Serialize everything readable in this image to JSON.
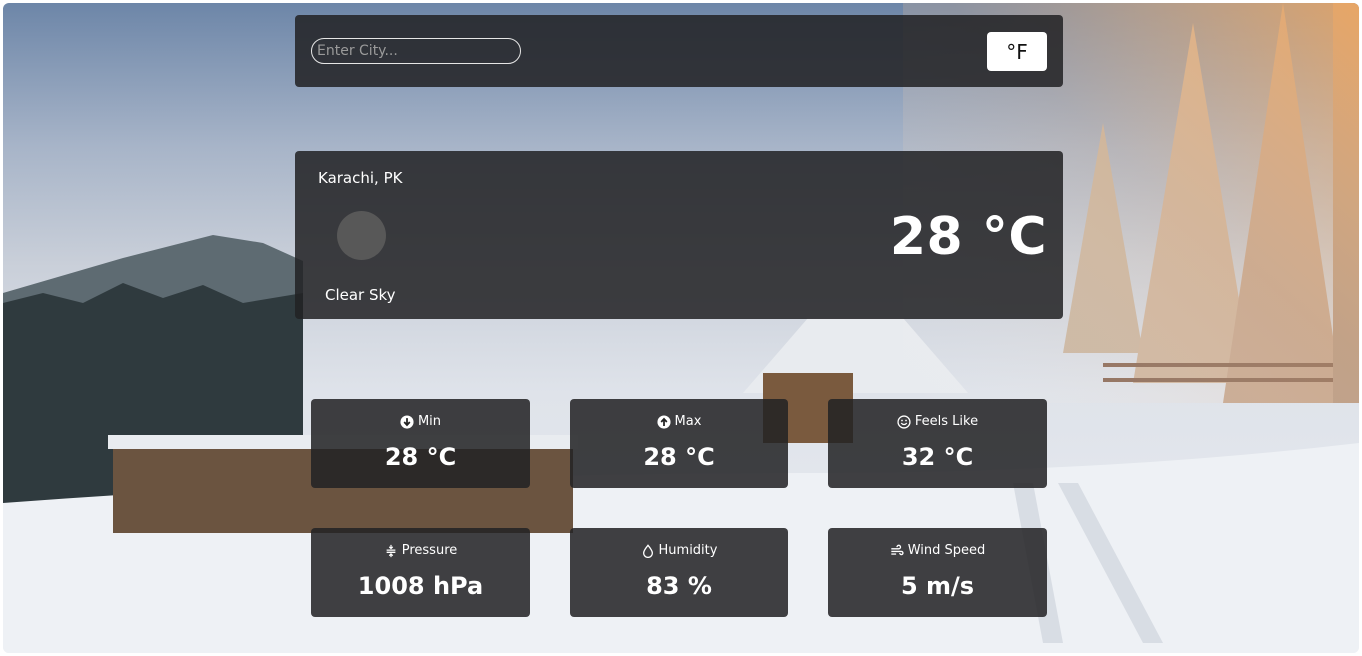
{
  "search": {
    "placeholder": "Enter City..."
  },
  "unit_toggle": {
    "label": "°F"
  },
  "current": {
    "location": "Karachi, PK",
    "description": "Clear Sky",
    "temperature": "28 °C"
  },
  "stats": [
    {
      "label": "Min",
      "value": "28 °C",
      "icon": "arrow-down-circle-icon"
    },
    {
      "label": "Max",
      "value": "28 °C",
      "icon": "arrow-up-circle-icon"
    },
    {
      "label": "Feels Like",
      "value": "32 °C",
      "icon": "smiley-icon"
    },
    {
      "label": "Pressure",
      "value": "1008 hPa",
      "icon": "pressure-icon"
    },
    {
      "label": "Humidity",
      "value": "83 %",
      "icon": "droplet-icon"
    },
    {
      "label": "Wind Speed",
      "value": "5 m/s",
      "icon": "wind-icon"
    }
  ],
  "colors": {
    "panel": "#222224",
    "button": "#ffffff"
  }
}
